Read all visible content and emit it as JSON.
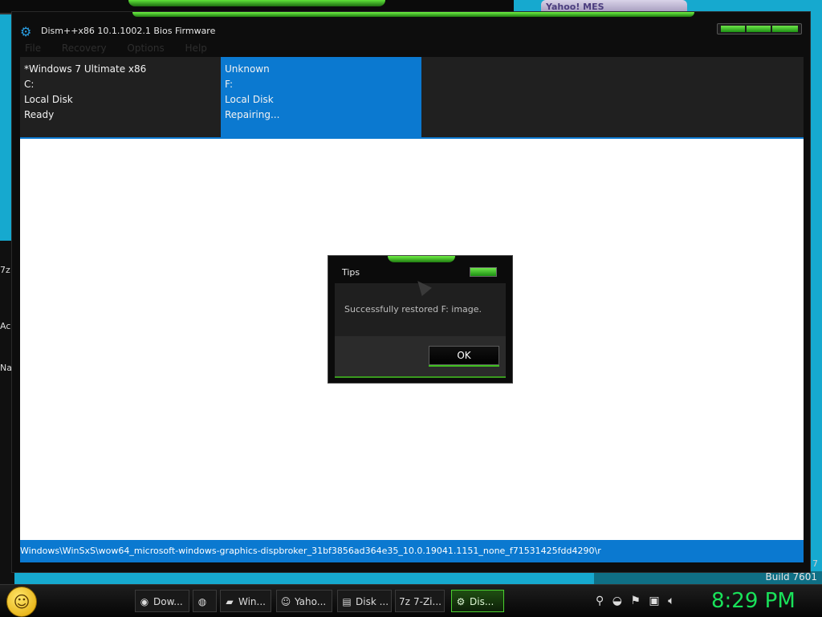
{
  "background": {
    "yahoo_tab_label": "Yahoo! MES",
    "left_strip_glyphs": [
      "7z",
      "Ac",
      "Na"
    ],
    "build_text": "Build 7601",
    "corner_digit": "7"
  },
  "window": {
    "title": "Dism++x86 10.1.1002.1 Bios Firmware",
    "app_icon": "gears-icon",
    "menu": [
      "File",
      "Recovery",
      "Options",
      "Help"
    ]
  },
  "sessions": [
    {
      "name": "*Windows 7 Ultimate x86",
      "drive": "C:",
      "type": "Local Disk",
      "status": "Ready",
      "active": false
    },
    {
      "name": "Unknown",
      "drive": "F:",
      "type": "Local Disk",
      "status": "Repairing...",
      "active": true
    }
  ],
  "status_bar": {
    "path": "Windows\\WinSxS\\wow64_microsoft-windows-graphics-dispbroker_31bf3856ad364e35_10.0.19041.1151_none_f71531425fdd4290\\r"
  },
  "dialog": {
    "title": "Tips",
    "message": "Successfully restored F: image.",
    "ok_label": "OK"
  },
  "taskbar": {
    "tasks": [
      {
        "label": "Dow...",
        "icon": "chrome-icon",
        "glyph": "◉"
      },
      {
        "label": "",
        "icon": "firefox-icon",
        "glyph": "◍"
      },
      {
        "label": "Win...",
        "icon": "folder-icon",
        "glyph": "▰"
      },
      {
        "label": "Yaho...",
        "icon": "yahoo-messenger-icon",
        "glyph": "☺"
      },
      {
        "label": "Disk ...",
        "icon": "disk-icon",
        "glyph": "▤"
      },
      {
        "label": "7-Zi...",
        "icon": "7zip-icon",
        "glyph": "7z"
      },
      {
        "label": "Dis...",
        "icon": "dism-icon",
        "glyph": "⚙"
      }
    ],
    "clock": "8:29 PM"
  },
  "colors": {
    "accent_blue": "#0b79d0",
    "accent_green": "#3fbf1f",
    "clock_green": "#19e25a"
  }
}
